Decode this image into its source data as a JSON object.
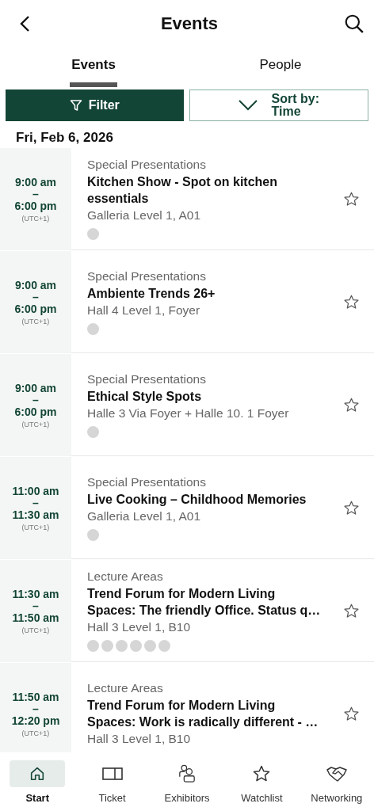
{
  "header": {
    "title": "Events"
  },
  "tabs": [
    {
      "label": "Events",
      "selected": true
    },
    {
      "label": "People",
      "selected": false
    }
  ],
  "filter_button": {
    "label": "Filter",
    "active": true
  },
  "sort_button": {
    "label": "Sort by:",
    "value": "Time"
  },
  "date": "Fri, Feb 6, 2026",
  "events": [
    {
      "start": "9:00 am",
      "dash": "–",
      "end": "6:00 pm",
      "timezone": "(UTC+1)",
      "category": "Special Presentations",
      "title": "Kitchen Show - Spot on kitchen essentials",
      "location": "Galleria Level 1, A01",
      "starred": false,
      "avatars": [
        {
          "kind": "placeholder"
        }
      ]
    },
    {
      "start": "9:00 am",
      "dash": "–",
      "end": "6:00 pm",
      "timezone": "(UTC+1)",
      "category": "Special Presentations",
      "title": "Ambiente Trends 26+",
      "location": "Hall 4 Level 1, Foyer",
      "starred": false,
      "avatars": [
        {
          "kind": "placeholder"
        }
      ]
    },
    {
      "start": "9:00 am",
      "dash": "–",
      "end": "6:00 pm",
      "timezone": "(UTC+1)",
      "category": "Special Presentations",
      "title": "Ethical Style Spots",
      "location": "Halle 3 Via Foyer + Halle 10. 1 Foyer",
      "starred": false,
      "avatars": [
        {
          "kind": "placeholder"
        }
      ]
    },
    {
      "start": "11:00 am",
      "dash": "–",
      "end": "11:30 am",
      "timezone": "(UTC+1)",
      "category": "Special Presentations",
      "title": "Live Cooking – Childhood Memories",
      "location": "Galleria Level 1, A01",
      "starred": false,
      "avatars": [
        {
          "kind": "placeholder"
        }
      ]
    },
    {
      "start": "11:30 am",
      "dash": "–",
      "end": "11:50 am",
      "timezone": "(UTC+1)",
      "category": "Lecture Areas",
      "title": "Trend Forum for Modern Living Spaces: The friendly Office. Status q…",
      "location": "Hall 3 Level 1, B10",
      "starred": false,
      "avatars": [
        {
          "kind": "placeholder"
        },
        {
          "kind": "placeholder"
        },
        {
          "kind": "placeholder"
        },
        {
          "kind": "placeholder"
        },
        {
          "kind": "placeholder"
        },
        {
          "kind": "placeholder"
        }
      ]
    },
    {
      "start": "11:50 am",
      "dash": "–",
      "end": "12:20 pm",
      "timezone": "(UTC+1)",
      "category": "Lecture Areas",
      "title": "Trend Forum for Modern Living Spaces: Work is radically different - …",
      "location": "Hall 3 Level 1, B10",
      "starred": false
    }
  ],
  "bottom_nav": [
    {
      "label": "Start",
      "kind": "home",
      "selected": true
    },
    {
      "label": "Ticket",
      "kind": "ticket",
      "selected": false
    },
    {
      "label": "Exhibitors",
      "kind": "people",
      "selected": false
    },
    {
      "label": "Watchlist",
      "kind": "star",
      "selected": false
    },
    {
      "label": "Networking",
      "kind": "handshake",
      "selected": false
    }
  ]
}
